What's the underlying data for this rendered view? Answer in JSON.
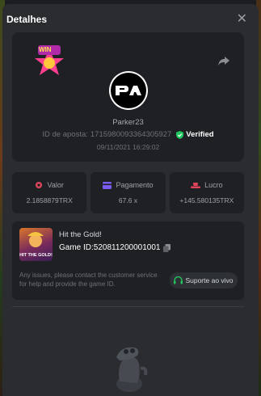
{
  "dialog": {
    "title": "Detalhes"
  },
  "bet": {
    "game_logo_text": "WIN",
    "username": "Parker23",
    "bet_id_label": "ID de aposta:",
    "bet_id": "1715980093364305927",
    "verified_label": "Verified",
    "datetime": "09/11/2021 16:29:02"
  },
  "stats": [
    {
      "label": "Valor",
      "value": "2.1858879TRX",
      "icon": "coins-icon",
      "color": "#e0445b"
    },
    {
      "label": "Pagamento",
      "value": "67.6 x",
      "icon": "card-icon",
      "color": "#7b5cf0"
    },
    {
      "label": "Lucro",
      "value": "+145.580135TRX",
      "icon": "hat-icon",
      "color": "#e0445b"
    }
  ],
  "game": {
    "name": "Hit the Gold!",
    "thumb_text": "HIT THE GOLD!",
    "id_label": "Game ID:",
    "id": "5208112000010​01",
    "note": "Any issues, please contact the customer service for help and provide the game ID.",
    "support_label": "Suporte ao vivo"
  },
  "colors": {
    "verified": "#22c55e",
    "accent_red": "#e0445b",
    "accent_purple": "#7b5cf0"
  }
}
